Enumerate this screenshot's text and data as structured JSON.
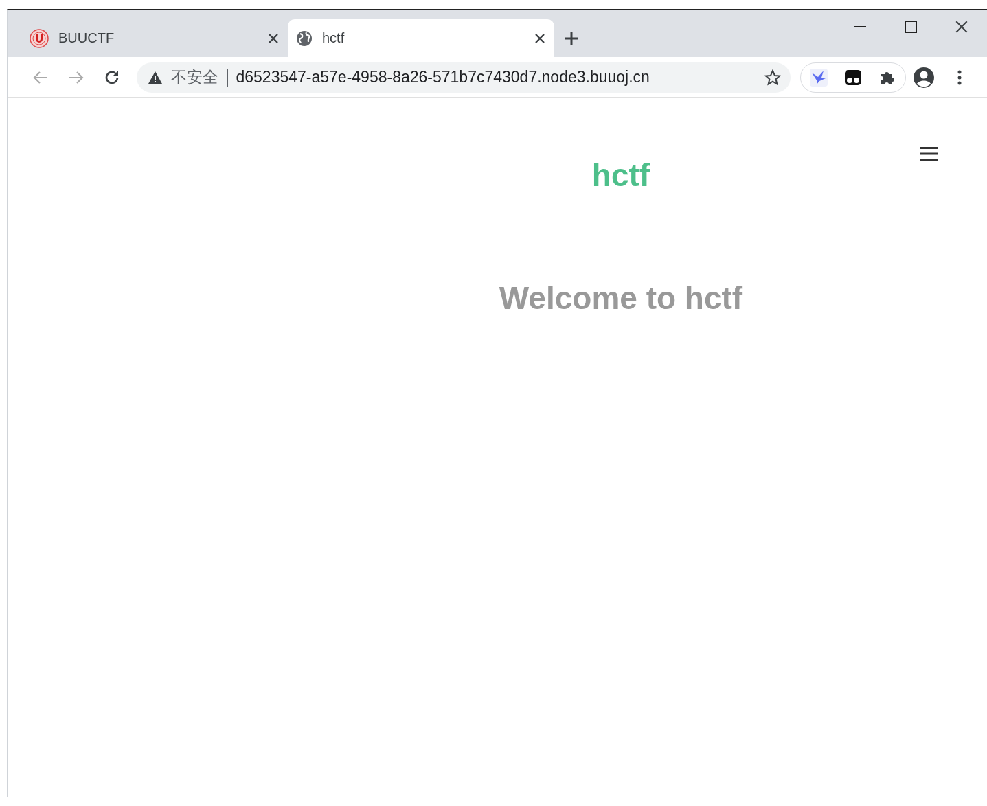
{
  "tabs": [
    {
      "title": "BUUCTF",
      "selected": false
    },
    {
      "title": "hctf",
      "selected": true
    }
  ],
  "address_bar": {
    "security_label": "不安全",
    "url": "d6523547-a57e-4958-8a26-571b7c7430d7.node3.buuoj.cn"
  },
  "page": {
    "brand": "hctf",
    "heading": "Welcome to hctf"
  }
}
